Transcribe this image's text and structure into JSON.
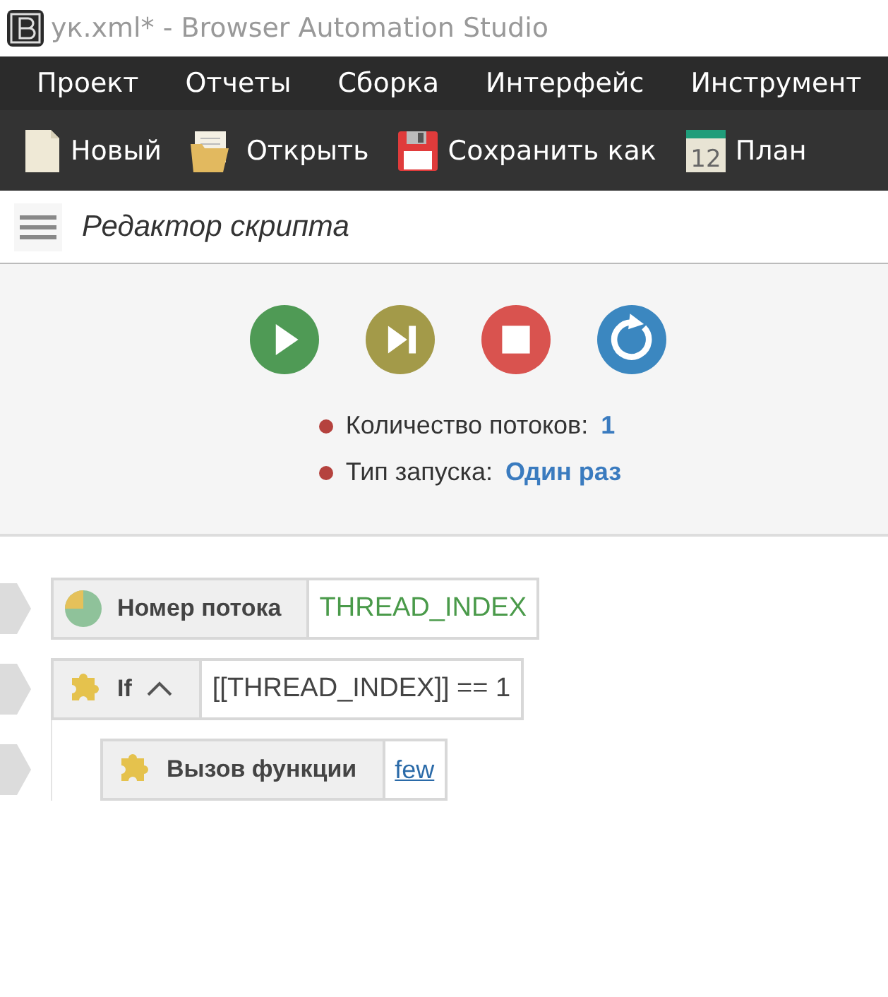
{
  "window": {
    "title": "ук.xml* - Browser Automation Studio"
  },
  "menu": [
    "Проект",
    "Отчеты",
    "Сборка",
    "Интерфейс",
    "Инструмент"
  ],
  "toolbar": [
    {
      "kind": "new",
      "label": "Новый"
    },
    {
      "kind": "open",
      "label": "Открыть"
    },
    {
      "kind": "save",
      "label": "Сохранить как"
    },
    {
      "kind": "calendar",
      "label": "План",
      "icon_text": "12"
    }
  ],
  "editor": {
    "title": "Редактор скрипта"
  },
  "controls": [
    {
      "kind": "play"
    },
    {
      "kind": "step"
    },
    {
      "kind": "stop"
    },
    {
      "kind": "restart"
    }
  ],
  "info": [
    {
      "label": "Количество потоков:",
      "value": "1"
    },
    {
      "label": "Тип запуска:",
      "value": "Один раз"
    }
  ],
  "script": [
    {
      "kind": "thread",
      "name": "Номер потока",
      "param": {
        "kind": "variable",
        "text": "THREAD_INDEX"
      }
    },
    {
      "kind": "puzzle",
      "name": "If",
      "expanded": true,
      "param": {
        "kind": "expression",
        "text": "[[THREAD_INDEX]] == 1"
      },
      "children": [
        {
          "kind": "puzzle",
          "name": "Вызов функции",
          "param": {
            "kind": "link",
            "text": "few"
          }
        }
      ]
    }
  ]
}
